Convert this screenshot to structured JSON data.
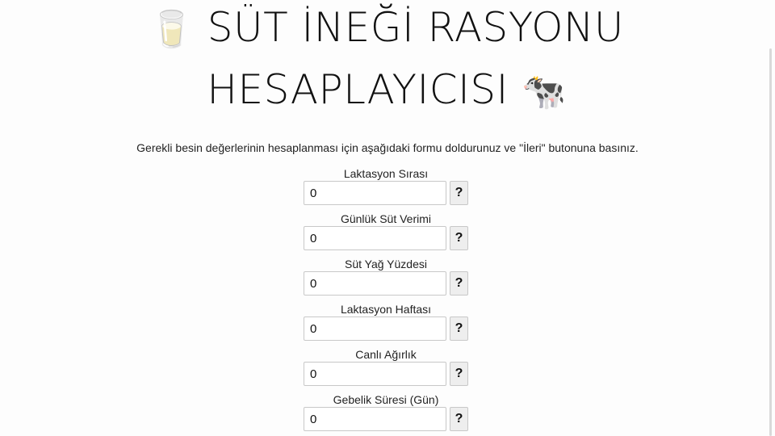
{
  "header": {
    "title_line1": "SÜT İNEĞİ RASYONU",
    "title_line2": "HESAPLAYICISI",
    "emoji_left": "🥛",
    "emoji_right": "🐄"
  },
  "intro_text": "Gerekli besin değerlerinin hesaplanması için aşağıdaki formu doldurunuz ve \"İleri\" butonuna basınız.",
  "form": {
    "fields": [
      {
        "label": "Laktasyon Sırası",
        "value": "0",
        "help": "?"
      },
      {
        "label": "Günlük Süt Verimi",
        "value": "0",
        "help": "?"
      },
      {
        "label": "Süt Yağ Yüzdesi",
        "value": "0",
        "help": "?"
      },
      {
        "label": "Laktasyon Haftası",
        "value": "0",
        "help": "?"
      },
      {
        "label": "Canlı Ağırlık",
        "value": "0",
        "help": "?"
      },
      {
        "label": "Gebelik Süresi (Gün)",
        "value": "0",
        "help": "?"
      }
    ]
  }
}
